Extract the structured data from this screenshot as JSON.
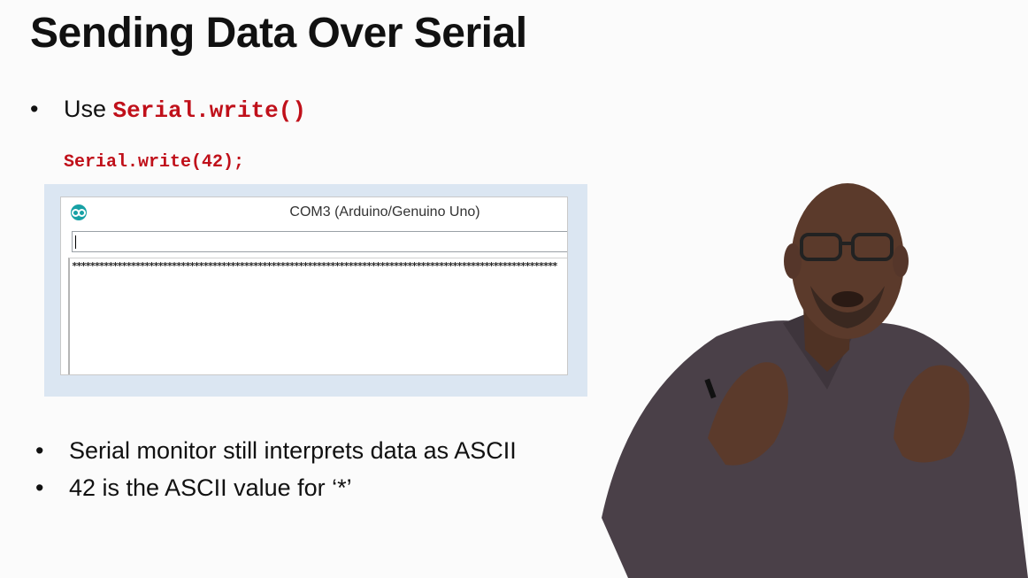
{
  "slide": {
    "title": "Sending Data Over Serial",
    "bullet_symbol": "•",
    "bullet1": {
      "text": "Use ",
      "code": "Serial.write()"
    },
    "code_example": "Serial.write(42);",
    "bullets": [
      "Serial monitor still interprets data as ASCII",
      "42 is the ASCII value for ‘*’"
    ]
  },
  "serial_monitor": {
    "window_title": "COM3 (Arduino/Genuino Uno)",
    "input_value": "",
    "output": "***********************************************************************************************************"
  },
  "colors": {
    "code": "#c0101a",
    "frame": "#dbe6f2",
    "arduino_icon": "#17a1a5",
    "shirt": "#4a4048",
    "skin": "#5b3a2b"
  },
  "icons": [
    "arduino-logo-icon"
  ]
}
